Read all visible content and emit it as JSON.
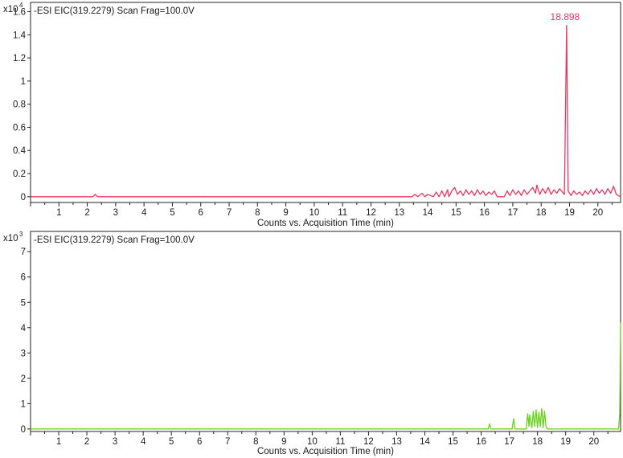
{
  "chart_data": [
    {
      "type": "line",
      "title": "-ESI EIC(319.2279) Scan Frag=100.0V",
      "xlabel": "Counts vs. Acquisition Time (min)",
      "y_multiplier_base": "x10",
      "y_multiplier_exp": "4",
      "xlim": [
        0,
        20.8
      ],
      "ylim": [
        -0.05,
        1.68
      ],
      "x_ticks": [
        1,
        2,
        3,
        4,
        5,
        6,
        7,
        8,
        9,
        10,
        11,
        12,
        13,
        14,
        15,
        16,
        17,
        18,
        19,
        20
      ],
      "y_ticks": [
        0,
        0.2,
        0.4,
        0.6,
        0.8,
        1,
        1.2,
        1.4,
        1.6
      ],
      "y_tick_labels": [
        "0",
        "0.2",
        "0.4",
        "0.6",
        "0.8",
        "1",
        "1.2",
        "1.4",
        "1.6"
      ],
      "color": "#e8385f",
      "grid": false,
      "series": [
        {
          "x": [
            0,
            2.2,
            2.28,
            2.36,
            13.45,
            13.55,
            13.65,
            13.8,
            13.9,
            14.0,
            14.2,
            14.3,
            14.4,
            14.5,
            14.6,
            14.7,
            14.75,
            14.85,
            14.95,
            15.05,
            15.15,
            15.25,
            15.35,
            15.45,
            15.55,
            15.65,
            15.75,
            15.85,
            15.95,
            16.05,
            16.15,
            16.25,
            16.35,
            16.45,
            16.7,
            16.8,
            16.9,
            17.0,
            17.1,
            17.2,
            17.3,
            17.4,
            17.5,
            17.6,
            17.7,
            17.8,
            17.85,
            17.95,
            18.05,
            18.15,
            18.25,
            18.35,
            18.45,
            18.55,
            18.65,
            18.75,
            18.82,
            18.898,
            18.95,
            19.05,
            19.15,
            19.25,
            19.35,
            19.45,
            19.55,
            19.65,
            19.75,
            19.85,
            19.95,
            20.05,
            20.15,
            20.25,
            20.35,
            20.45,
            20.55,
            20.65,
            20.8
          ],
          "y": [
            0,
            0,
            0.02,
            0,
            0,
            0.02,
            0,
            0.03,
            0,
            0.02,
            0,
            0.04,
            0,
            0.05,
            0,
            0.06,
            0,
            0.05,
            0.08,
            0.02,
            0.05,
            0.01,
            0.06,
            0.02,
            0.05,
            0.01,
            0.06,
            0.02,
            0.05,
            0.01,
            0.04,
            0.02,
            0.05,
            0,
            0,
            0.05,
            0.01,
            0.06,
            0.02,
            0.05,
            0.01,
            0.06,
            0.02,
            0.05,
            0.08,
            0.03,
            0.1,
            0.02,
            0.07,
            0.03,
            0.08,
            0.02,
            0.06,
            0.03,
            0.07,
            0.04,
            0.02,
            1.48,
            0.05,
            0.01,
            0.05,
            0.02,
            0.04,
            0.01,
            0.05,
            0.02,
            0.06,
            0.02,
            0.07,
            0.03,
            0.06,
            0.02,
            0.07,
            0.03,
            0.09,
            0.02,
            0
          ]
        }
      ],
      "annotations": [
        {
          "x": 18.898,
          "y": 1.48,
          "text": "18.898"
        }
      ]
    },
    {
      "type": "line",
      "title": "-ESI EIC(319.2279) Scan Frag=100.0V",
      "xlabel": "Counts vs. Acquisition Time (min)",
      "y_multiplier_base": "x10",
      "y_multiplier_exp": "3",
      "xlim": [
        0,
        20.95
      ],
      "ylim": [
        -0.1,
        7.8
      ],
      "x_ticks": [
        1,
        2,
        3,
        4,
        5,
        6,
        7,
        8,
        9,
        10,
        11,
        12,
        13,
        14,
        15,
        16,
        17,
        18,
        19,
        20
      ],
      "y_ticks": [
        0,
        1,
        2,
        3,
        4,
        5,
        6,
        7
      ],
      "y_tick_labels": [
        "0",
        "1",
        "2",
        "3",
        "4",
        "5",
        "6",
        "7"
      ],
      "color": "#66d21a",
      "grid": false,
      "series": [
        {
          "x": [
            0,
            16.25,
            16.3,
            16.35,
            17.1,
            17.15,
            17.2,
            17.6,
            17.65,
            17.7,
            17.72,
            17.8,
            17.85,
            17.9,
            17.95,
            18.0,
            18.05,
            18.1,
            18.15,
            18.2,
            18.25,
            18.3,
            18.35,
            20.88,
            20.92,
            20.95
          ],
          "y": [
            0,
            0,
            0.2,
            0,
            0,
            0.4,
            0,
            0,
            0.6,
            0.1,
            0.55,
            0.05,
            0.7,
            0.1,
            0.75,
            0.05,
            0.65,
            0.1,
            0.8,
            0.05,
            0.7,
            0.1,
            0,
            0,
            0.6,
            4.2
          ]
        }
      ],
      "annotations": []
    }
  ]
}
